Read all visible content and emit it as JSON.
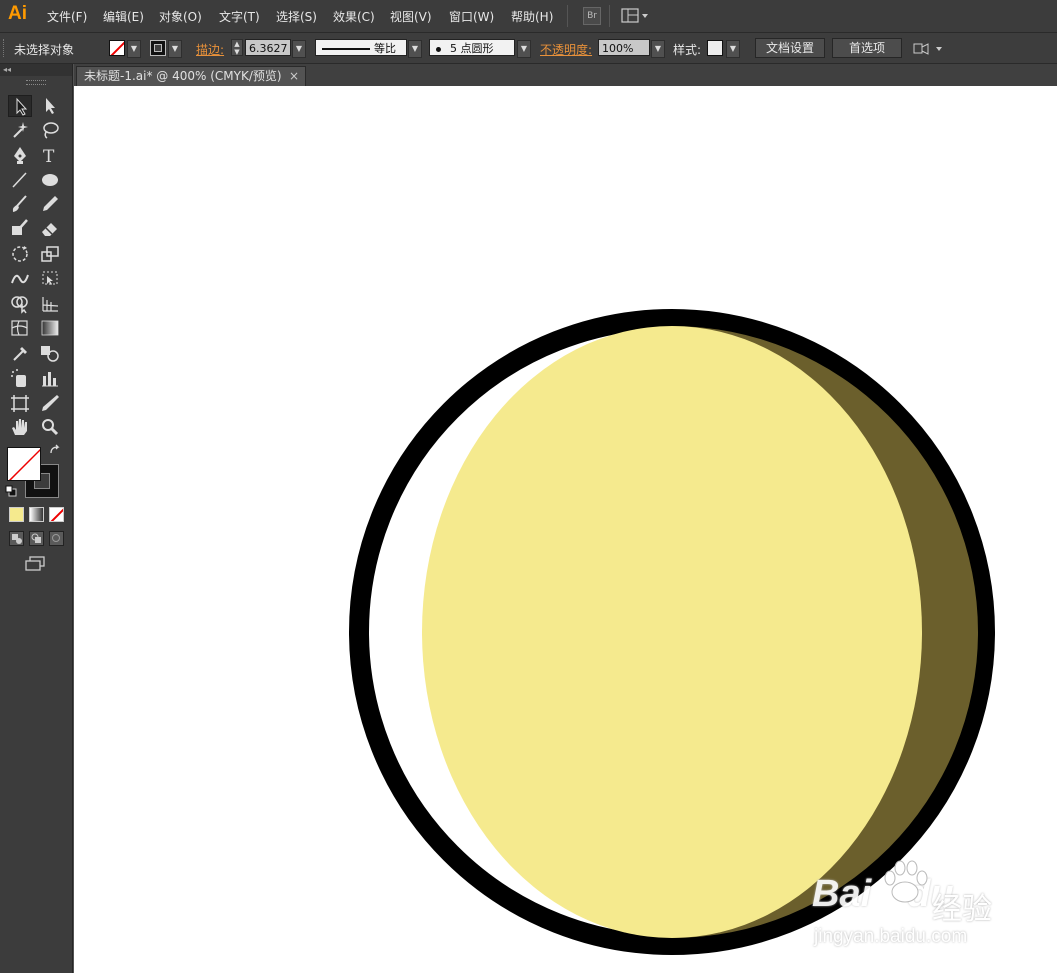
{
  "app": {
    "logo": "Ai"
  },
  "menu": [
    "文件(F)",
    "编辑(E)",
    "对象(O)",
    "文字(T)",
    "选择(S)",
    "效果(C)",
    "视图(V)",
    "窗口(W)",
    "帮助(H)"
  ],
  "menu_buttons": {
    "bridge": "Br"
  },
  "control": {
    "selection_status": "未选择对象",
    "stroke_label": "描边:",
    "stroke_weight": "6.3627",
    "stroke_profile": "等比",
    "brush": "5 点圆形",
    "opacity_label": "不透明度:",
    "opacity_value": "100%",
    "style_label": "样式:",
    "doc_setup_button": "文档设置",
    "preferences_button": "首选项"
  },
  "document_tab": {
    "title": "未标题-1.ai* @ 400% (CMYK/预览)",
    "close": "×"
  },
  "tools_panel": {
    "collapse": "◂◂"
  },
  "artwork": {
    "ring_color": "#000000",
    "moon_fill": "#f5ea8e",
    "shadow_fill": "#6b5f2c",
    "background": "#ffffff"
  },
  "watermark": {
    "brand": "Bai",
    "brand2": "du",
    "cn": "经验",
    "url": "jingyan.baidu.com"
  }
}
